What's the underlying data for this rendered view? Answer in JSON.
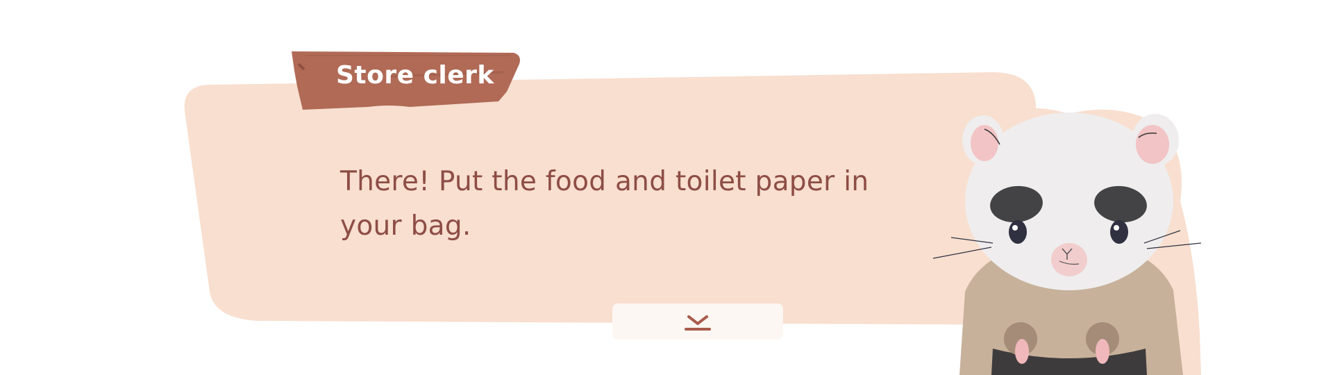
{
  "speaker": {
    "name": "Store clerk"
  },
  "dialog": {
    "text": "There! Put the food and toilet paper in your bag."
  },
  "continue_button": {
    "icon": "chevron-down-icon"
  },
  "character": {
    "kind": "hamster-store-clerk"
  },
  "colors": {
    "dialog_panel": "#f8dfcf",
    "name_plank": "#b06a56",
    "dialog_text": "#8d4d45",
    "button_bg": "#fdf7f3"
  }
}
